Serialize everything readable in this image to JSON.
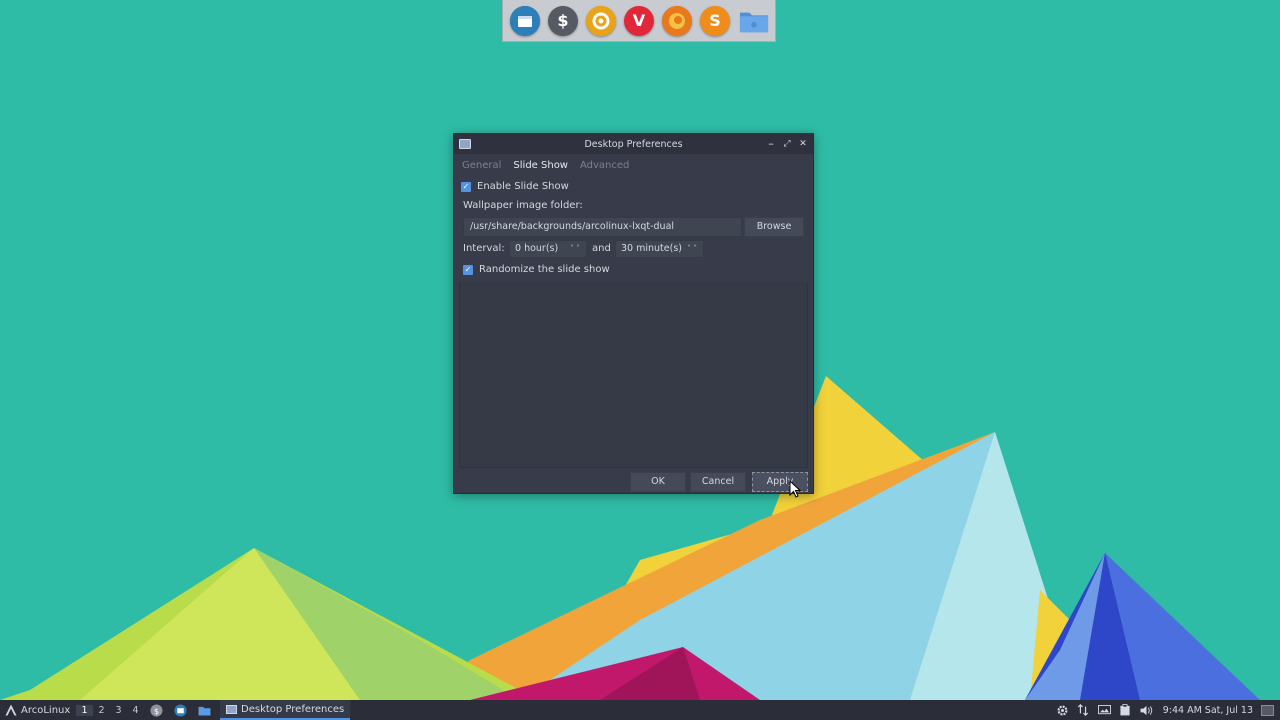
{
  "dock": {
    "icons": [
      "file-manager-icon",
      "terminal-icon",
      "settings-icon",
      "vivaldi-icon",
      "firefox-icon",
      "sublime-icon",
      "folder-icon"
    ],
    "terminal_glyph": "$",
    "vivaldi_glyph": "V",
    "sublime_glyph": "S"
  },
  "window": {
    "title": "Desktop Preferences",
    "controls": {
      "minimize": "–",
      "maximize": "⤢",
      "close": "✕"
    },
    "tabs": [
      {
        "label": "General",
        "active": false
      },
      {
        "label": "Slide Show",
        "active": true
      },
      {
        "label": "Advanced",
        "active": false
      }
    ],
    "enable_slideshow": {
      "label": "Enable Slide Show",
      "checked": true
    },
    "folder_label": "Wallpaper image folder:",
    "folder_path": "/usr/share/backgrounds/arcolinux-lxqt-dual",
    "browse_label": "Browse",
    "interval_label": "Interval:",
    "hours_value": "0 hour(s)",
    "and_label": "and",
    "minutes_value": "30 minute(s)",
    "randomize": {
      "label": "Randomize the slide show",
      "checked": true
    },
    "buttons": {
      "ok": "OK",
      "cancel": "Cancel",
      "apply": "Apply"
    }
  },
  "taskbar": {
    "start_label": "ArcoLinux",
    "workspaces": [
      "1",
      "2",
      "3",
      "4"
    ],
    "active_workspace": "1",
    "task_label": "Desktop Preferences",
    "clock": "9:44 AM Sat, Jul 13"
  },
  "colors": {
    "desktop_bg": "#2fbca6",
    "accent": "#5294e2",
    "window_bg": "#383c4a",
    "taskbar_bg": "#2b2e39"
  }
}
